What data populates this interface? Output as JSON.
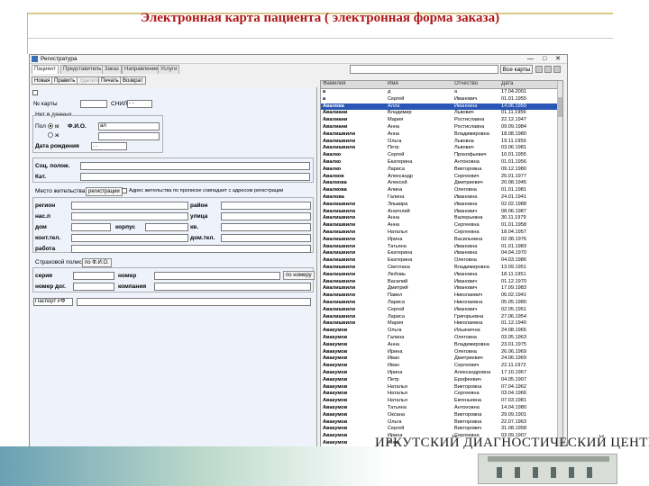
{
  "slide": {
    "title": "Электронная карта пациента ( электронная форма заказа)"
  },
  "window": {
    "title": "Регистратура",
    "buttons": "— □ ✕"
  },
  "tabs": [
    {
      "label": "Пациент"
    },
    {
      "label": "Представитель"
    },
    {
      "label": "Заказ"
    },
    {
      "label": "Направление"
    },
    {
      "label": "Услуги"
    }
  ],
  "toolbar": [
    {
      "label": "Новая"
    },
    {
      "label": "Править"
    },
    {
      "label": "Удалить"
    },
    {
      "label": "Печать"
    },
    {
      "label": "Возврат"
    }
  ],
  "search": {
    "button": "Все карты"
  },
  "form": {
    "card_no_label": "№ карты",
    "snils_label": "СНИЛС",
    "snils_value": "- -",
    "no_data_label": "Нет в данных",
    "gender_label": "Пол",
    "gender_m": "м",
    "gender_f": "ж",
    "fio_label": "Ф.И.О.",
    "fio_value": "ал",
    "dob_label": "Дата рождения",
    "dob_value": ". .",
    "social_label": "Соц. полож.",
    "category_label": "Кат.",
    "address_group": "Место жительства",
    "address_button": "регистрации",
    "address_same": "Адрес жительства по прописке совпадает с адресом регистрации",
    "region_label": "регион",
    "district_label": "район",
    "locality_label": "нас.п",
    "street_label": "улица",
    "house_label": "дом",
    "building_label": "корпус",
    "apt_label": "кв.",
    "contact_phone_label": "конт.тел.",
    "home_phone_label": "дом.тел.",
    "work_label": "работа",
    "insurance_group": "Страховой полис",
    "insurance_button": "по Ф.И.О.",
    "series_label": "серия",
    "number_label": "номер",
    "contract_label": "номер дог.",
    "company_label": "компания",
    "policy_button": "по номеру",
    "doc_type": "Паспорт РФ"
  },
  "table": {
    "headers": [
      "Фамилия",
      "Имя",
      "Отчество",
      "Дата"
    ],
    "rows": [
      [
        "а",
        "д",
        "а",
        "17.04.2001"
      ],
      [
        "а",
        "Сергей",
        "Иванович",
        "01.01.1955"
      ],
      [
        "Авалова",
        "Алла",
        "Ивановна",
        "14.06.1950"
      ],
      [
        "Авалиани",
        "Владимир",
        "Львович",
        "01.11.1956"
      ],
      [
        "Авалиани",
        "Мария",
        "Ростиславна",
        "22.12.1947"
      ],
      [
        "Авалиани",
        "Анна",
        "Ростиславна",
        "09.09.1984"
      ],
      [
        "Авалишвили",
        "Анна",
        "Владимировна",
        "18.08.1980"
      ],
      [
        "Авалишвили",
        "Ольга",
        "Львовна",
        "19.11.1959"
      ],
      [
        "Авалишвили",
        "Петр",
        "Львович",
        "03.06.1981"
      ],
      [
        "Авалко",
        "Сергей",
        "Прокофьевич",
        "10.01.1955"
      ],
      [
        "Авалко",
        "Екатерина",
        "Антоновна",
        "01.01.1956"
      ],
      [
        "Авалко",
        "Лариса",
        "Викторовна",
        "09.12.1980"
      ],
      [
        "Авалков",
        "Александр",
        "Сергеевич",
        "25.01.1977"
      ],
      [
        "Авалкова",
        "Алексей",
        "Дмитриевич",
        "20.08.1945"
      ],
      [
        "Авалкова",
        "Алина",
        "Олеговна",
        "01.01.1981"
      ],
      [
        "Авалова",
        "Галина",
        "Ивановна",
        "24.01.1941"
      ],
      [
        "Авалишвили",
        "Эльвира",
        "Ивановна",
        "02.02.1988"
      ],
      [
        "Авалишвили",
        "Анатолий",
        "Иванович",
        "08.06.1987"
      ],
      [
        "Авалишвили",
        "Анна",
        "Валерьевна",
        "30.11.1979"
      ],
      [
        "Авалишвили",
        "Анна",
        "Сергеевна",
        "01.01.1958"
      ],
      [
        "Авалишвили",
        "Наталья",
        "Сергеевна",
        "18.04.1957"
      ],
      [
        "Авалишвили",
        "Ирина",
        "Васильевна",
        "02.08.1976"
      ],
      [
        "Авалишвили",
        "Татьяна",
        "Ивановна",
        "01.01.1983"
      ],
      [
        "Авалишвили",
        "Екатерина",
        "Ивановна",
        "04.04.1970"
      ],
      [
        "Авалишвили",
        "Екатерина",
        "Олеговна",
        "04.03.1986"
      ],
      [
        "Авалишвили",
        "Светлана",
        "Владимировна",
        "13.09.1951"
      ],
      [
        "Авалишвили",
        "Любовь",
        "Ивановна",
        "18.11.1951"
      ],
      [
        "Авалишвили",
        "Василий",
        "Иванович",
        "01.12.1970"
      ],
      [
        "Авалишвили",
        "Дмитрий",
        "Иванович",
        "17.09.1983"
      ],
      [
        "Авалишвили",
        "Павел",
        "Николаевич",
        "06.02.1941"
      ],
      [
        "Авалишвили",
        "Лариса",
        "Николаевна",
        "05.05.1980"
      ],
      [
        "Авалишвили",
        "Сергей",
        "Иванович",
        "02.05.1951"
      ],
      [
        "Авалишвили",
        "Лариса",
        "Григорьевна",
        "27.06.1954"
      ],
      [
        "Авалишвили",
        "Мария",
        "Николаевна",
        "01.12.1940"
      ],
      [
        "Авакумов",
        "Ольга",
        "Ильинична",
        "24.08.1965"
      ],
      [
        "Авакумов",
        "Галина",
        "Олеговна",
        "03.05.1963"
      ],
      [
        "Авакумов",
        "Анна",
        "Владимировна",
        "23.01.1975"
      ],
      [
        "Авакумов",
        "Ирина",
        "Олеговна",
        "26.06.1969"
      ],
      [
        "Авакумов",
        "Иван",
        "Дмитриевич",
        "24.06.1969"
      ],
      [
        "Авакумов",
        "Иван",
        "Сергеевич",
        "22.11.1972"
      ],
      [
        "Авакумов",
        "Ирина",
        "Александровна",
        "17.10.1967"
      ],
      [
        "Авакумов",
        "Петр",
        "Ерофеевич",
        "04.05.1907"
      ],
      [
        "Авакумов",
        "Наталья",
        "Викторовна",
        "07.04.1962"
      ],
      [
        "Авакумов",
        "Наталья",
        "Сергеевна",
        "03.04.1966"
      ],
      [
        "Авакумов",
        "Наталья",
        "Евгеньевна",
        "07.03.1981"
      ],
      [
        "Авакумов",
        "Татьяна",
        "Антоновна",
        "14.04.1980"
      ],
      [
        "Авакумов",
        "Оксана",
        "Викторовна",
        "29.09.1901"
      ],
      [
        "Авакумов",
        "Ольга",
        "Викторовна",
        "22.07.1963"
      ],
      [
        "Авакумов",
        "Сергей",
        "Викторович",
        "31.08.1958"
      ],
      [
        "Авакумов",
        "Ирина",
        "Сергеевна",
        "03.09.1907"
      ],
      [
        "Авакумов",
        "Анна",
        "",
        ""
      ],
      [
        "Авакумов",
        "Анна",
        "",
        ""
      ]
    ]
  },
  "footer": {
    "org": "ИРКУТСКИЙ ДИАГНОСТИЧЕСКИЙ ЦЕНТР"
  }
}
